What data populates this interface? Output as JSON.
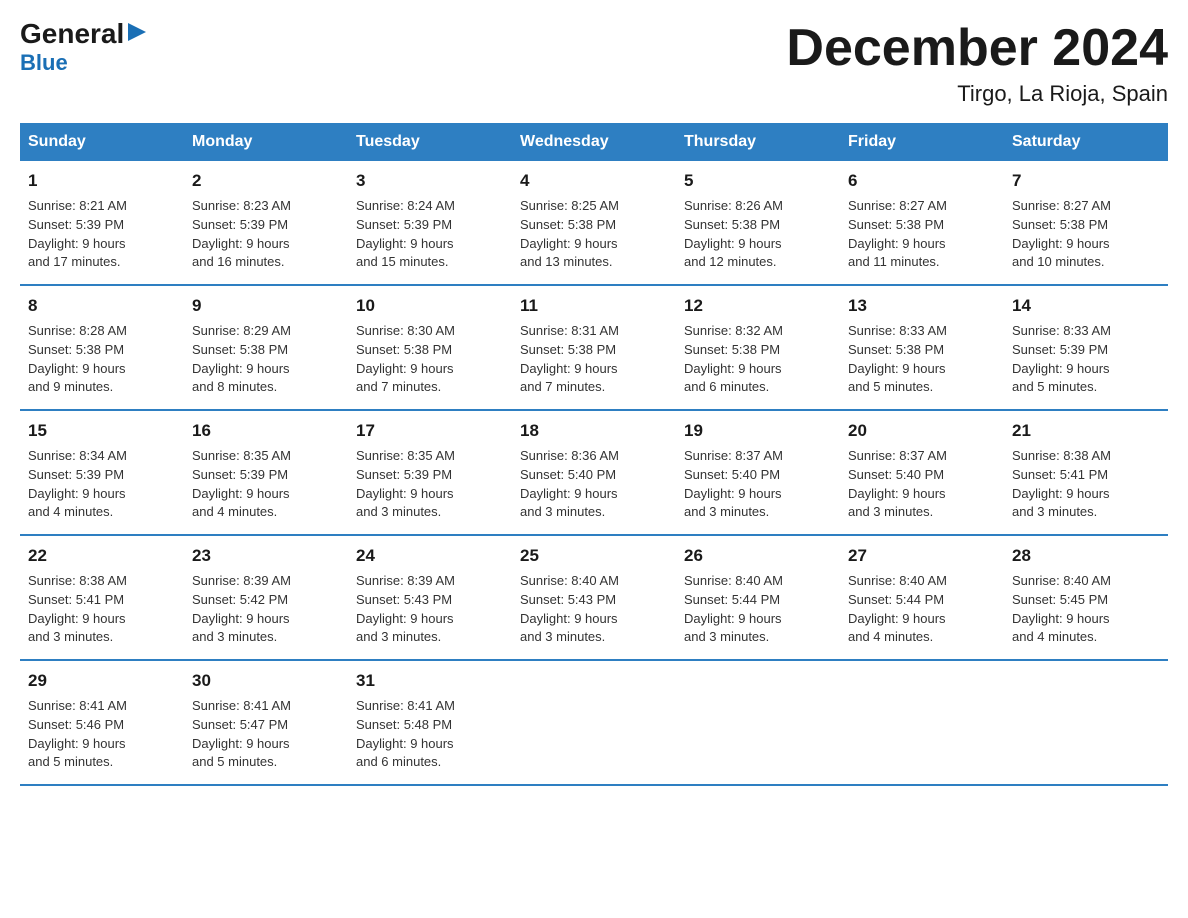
{
  "logo": {
    "part1": "General",
    "triangle": "▶",
    "part2": "Blue"
  },
  "title": "December 2024",
  "subtitle": "Tirgo, La Rioja, Spain",
  "days_header": [
    "Sunday",
    "Monday",
    "Tuesday",
    "Wednesday",
    "Thursday",
    "Friday",
    "Saturday"
  ],
  "weeks": [
    [
      {
        "day": "1",
        "sunrise": "8:21 AM",
        "sunset": "5:39 PM",
        "daylight": "9 hours and 17 minutes."
      },
      {
        "day": "2",
        "sunrise": "8:23 AM",
        "sunset": "5:39 PM",
        "daylight": "9 hours and 16 minutes."
      },
      {
        "day": "3",
        "sunrise": "8:24 AM",
        "sunset": "5:39 PM",
        "daylight": "9 hours and 15 minutes."
      },
      {
        "day": "4",
        "sunrise": "8:25 AM",
        "sunset": "5:38 PM",
        "daylight": "9 hours and 13 minutes."
      },
      {
        "day": "5",
        "sunrise": "8:26 AM",
        "sunset": "5:38 PM",
        "daylight": "9 hours and 12 minutes."
      },
      {
        "day": "6",
        "sunrise": "8:27 AM",
        "sunset": "5:38 PM",
        "daylight": "9 hours and 11 minutes."
      },
      {
        "day": "7",
        "sunrise": "8:27 AM",
        "sunset": "5:38 PM",
        "daylight": "9 hours and 10 minutes."
      }
    ],
    [
      {
        "day": "8",
        "sunrise": "8:28 AM",
        "sunset": "5:38 PM",
        "daylight": "9 hours and 9 minutes."
      },
      {
        "day": "9",
        "sunrise": "8:29 AM",
        "sunset": "5:38 PM",
        "daylight": "9 hours and 8 minutes."
      },
      {
        "day": "10",
        "sunrise": "8:30 AM",
        "sunset": "5:38 PM",
        "daylight": "9 hours and 7 minutes."
      },
      {
        "day": "11",
        "sunrise": "8:31 AM",
        "sunset": "5:38 PM",
        "daylight": "9 hours and 7 minutes."
      },
      {
        "day": "12",
        "sunrise": "8:32 AM",
        "sunset": "5:38 PM",
        "daylight": "9 hours and 6 minutes."
      },
      {
        "day": "13",
        "sunrise": "8:33 AM",
        "sunset": "5:38 PM",
        "daylight": "9 hours and 5 minutes."
      },
      {
        "day": "14",
        "sunrise": "8:33 AM",
        "sunset": "5:39 PM",
        "daylight": "9 hours and 5 minutes."
      }
    ],
    [
      {
        "day": "15",
        "sunrise": "8:34 AM",
        "sunset": "5:39 PM",
        "daylight": "9 hours and 4 minutes."
      },
      {
        "day": "16",
        "sunrise": "8:35 AM",
        "sunset": "5:39 PM",
        "daylight": "9 hours and 4 minutes."
      },
      {
        "day": "17",
        "sunrise": "8:35 AM",
        "sunset": "5:39 PM",
        "daylight": "9 hours and 3 minutes."
      },
      {
        "day": "18",
        "sunrise": "8:36 AM",
        "sunset": "5:40 PM",
        "daylight": "9 hours and 3 minutes."
      },
      {
        "day": "19",
        "sunrise": "8:37 AM",
        "sunset": "5:40 PM",
        "daylight": "9 hours and 3 minutes."
      },
      {
        "day": "20",
        "sunrise": "8:37 AM",
        "sunset": "5:40 PM",
        "daylight": "9 hours and 3 minutes."
      },
      {
        "day": "21",
        "sunrise": "8:38 AM",
        "sunset": "5:41 PM",
        "daylight": "9 hours and 3 minutes."
      }
    ],
    [
      {
        "day": "22",
        "sunrise": "8:38 AM",
        "sunset": "5:41 PM",
        "daylight": "9 hours and 3 minutes."
      },
      {
        "day": "23",
        "sunrise": "8:39 AM",
        "sunset": "5:42 PM",
        "daylight": "9 hours and 3 minutes."
      },
      {
        "day": "24",
        "sunrise": "8:39 AM",
        "sunset": "5:43 PM",
        "daylight": "9 hours and 3 minutes."
      },
      {
        "day": "25",
        "sunrise": "8:40 AM",
        "sunset": "5:43 PM",
        "daylight": "9 hours and 3 minutes."
      },
      {
        "day": "26",
        "sunrise": "8:40 AM",
        "sunset": "5:44 PM",
        "daylight": "9 hours and 3 minutes."
      },
      {
        "day": "27",
        "sunrise": "8:40 AM",
        "sunset": "5:44 PM",
        "daylight": "9 hours and 4 minutes."
      },
      {
        "day": "28",
        "sunrise": "8:40 AM",
        "sunset": "5:45 PM",
        "daylight": "9 hours and 4 minutes."
      }
    ],
    [
      {
        "day": "29",
        "sunrise": "8:41 AM",
        "sunset": "5:46 PM",
        "daylight": "9 hours and 5 minutes."
      },
      {
        "day": "30",
        "sunrise": "8:41 AM",
        "sunset": "5:47 PM",
        "daylight": "9 hours and 5 minutes."
      },
      {
        "day": "31",
        "sunrise": "8:41 AM",
        "sunset": "5:48 PM",
        "daylight": "9 hours and 6 minutes."
      },
      null,
      null,
      null,
      null
    ]
  ],
  "labels": {
    "sunrise": "Sunrise:",
    "sunset": "Sunset:",
    "daylight": "Daylight:"
  }
}
